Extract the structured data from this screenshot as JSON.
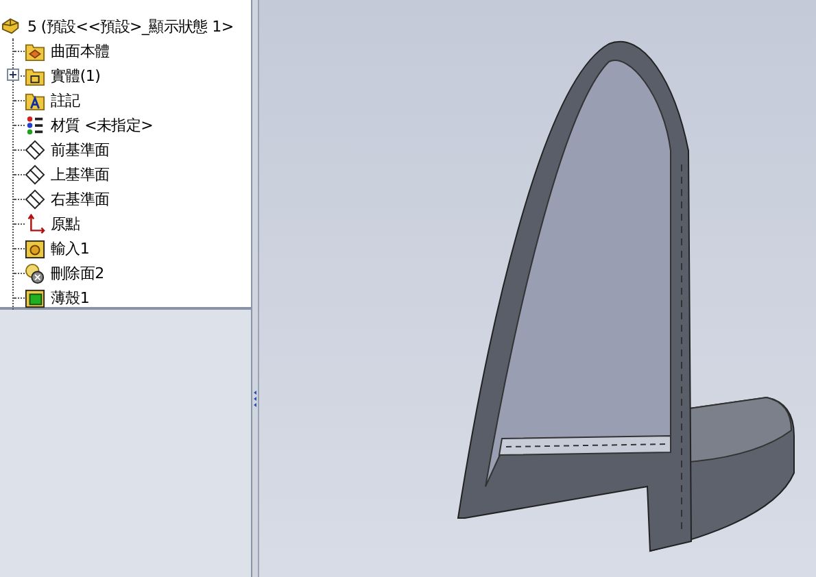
{
  "feature_tree": {
    "root": {
      "label": "5 (預設<<預設>_顯示狀態 1>",
      "kind": "part"
    },
    "items": [
      {
        "label": "曲面本體",
        "kind": "surface-folder",
        "expandable": false
      },
      {
        "label": "實體(1)",
        "kind": "solid-folder",
        "expandable": true
      },
      {
        "label": "註記",
        "kind": "annotation-folder",
        "expandable": false
      },
      {
        "label": "材質 <未指定>",
        "kind": "material",
        "expandable": false
      },
      {
        "label": "前基準面",
        "kind": "plane",
        "expandable": false
      },
      {
        "label": "上基準面",
        "kind": "plane",
        "expandable": false
      },
      {
        "label": "右基準面",
        "kind": "plane",
        "expandable": false
      },
      {
        "label": "原點",
        "kind": "origin",
        "expandable": false
      },
      {
        "label": "輸入1",
        "kind": "import",
        "expandable": false
      },
      {
        "label": "刪除面2",
        "kind": "delete-face",
        "expandable": false
      },
      {
        "label": "薄殼1",
        "kind": "shell",
        "expandable": false
      }
    ]
  }
}
